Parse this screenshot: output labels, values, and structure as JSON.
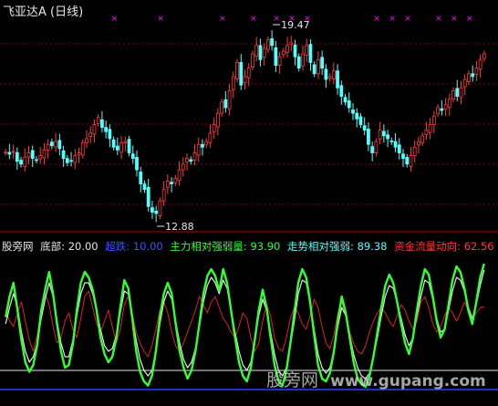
{
  "header": {
    "title": "飞亚达A (日线)"
  },
  "price": {
    "high_label": "19.47",
    "low_label": "12.88"
  },
  "legend": {
    "source": "股旁网",
    "bottom_label": "底部:",
    "bottom_value": "20.00",
    "super_label": "超跌:",
    "super_value": "10.00",
    "main_label": "主力相对强弱量:",
    "main_value": "93.90",
    "trend_label": "走势相对强弱:",
    "trend_value": "89.38",
    "flow_label": "资金流量动向:",
    "flow_value": "62.56"
  },
  "watermark": {
    "cn": "股旁网",
    "url": "www.gupang.com"
  },
  "colors": {
    "up": "#ff3b3b",
    "down": "#54ffff",
    "signal": "#ff00ff",
    "green": "#33ff33",
    "white": "#e6e6e6",
    "blue": "#2a40ff",
    "red": "#e02020",
    "grid": "#8a0000"
  },
  "chart_data": [
    {
      "type": "candlestick",
      "title": "飞亚达A (日线)",
      "annotations": [
        {
          "label": "19.47",
          "value": 19.47
        },
        {
          "label": "12.88",
          "value": 12.88
        }
      ],
      "close": [
        15.22,
        15.15,
        15.25,
        14.9,
        14.8,
        15.05,
        15.2,
        15.0,
        14.95,
        15.1,
        15.3,
        15.5,
        15.45,
        15.6,
        15.35,
        15.0,
        14.85,
        14.9,
        15.1,
        15.2,
        15.55,
        15.7,
        15.9,
        16.2,
        16.45,
        16.1,
        15.95,
        15.7,
        15.4,
        15.3,
        15.55,
        15.6,
        15.2,
        15.0,
        14.6,
        14.1,
        13.9,
        13.3,
        13.1,
        13.05,
        13.5,
        13.9,
        14.2,
        14.1,
        14.3,
        14.6,
        14.8,
        15.0,
        14.9,
        15.2,
        15.5,
        15.4,
        15.6,
        15.9,
        16.2,
        16.6,
        17.0,
        16.8,
        17.4,
        17.9,
        18.4,
        17.6,
        17.9,
        18.2,
        18.7,
        19.0,
        18.5,
        18.9,
        19.2,
        19.0,
        18.3,
        18.6,
        18.8,
        19.0,
        19.1,
        18.6,
        18.2,
        18.7,
        19.0,
        18.4,
        18.0,
        18.5,
        18.2,
        17.8,
        17.9,
        18.1,
        17.5,
        17.2,
        17.0,
        16.8,
        16.6,
        16.4,
        16.2,
        16.0,
        15.5,
        15.2,
        15.6,
        16.0,
        15.8,
        15.7,
        15.6,
        15.4,
        15.2,
        15.0,
        14.8,
        15.1,
        15.4,
        15.6,
        15.8,
        16.0,
        16.2,
        16.5,
        16.8,
        16.7,
        16.9,
        17.1,
        17.4,
        17.2,
        17.5,
        17.8,
        18.0,
        17.9,
        18.2,
        18.5,
        18.7
      ]
    },
    {
      "type": "line",
      "series": [
        {
          "name": "主力相对强弱量",
          "color": "#33ff33",
          "values": [
            55,
            70,
            80,
            60,
            38,
            22,
            15,
            20,
            35,
            60,
            75,
            88,
            72,
            50,
            30,
            18,
            20,
            35,
            60,
            80,
            88,
            84,
            75,
            60,
            40,
            28,
            22,
            26,
            40,
            62,
            82,
            76,
            55,
            30,
            15,
            8,
            5,
            12,
            30,
            55,
            72,
            80,
            72,
            50,
            30,
            18,
            10,
            16,
            30,
            50,
            72,
            85,
            90,
            85,
            74,
            90,
            80,
            60,
            40,
            22,
            12,
            8,
            18,
            38,
            60,
            75,
            62,
            40,
            20,
            8,
            5,
            16,
            36,
            58,
            80,
            90,
            84,
            66,
            42,
            20,
            10,
            8,
            14,
            30,
            52,
            70,
            58,
            40,
            22,
            10,
            6,
            4,
            12,
            26,
            44,
            62,
            78,
            86,
            80,
            66,
            50,
            36,
            28,
            40,
            60,
            78,
            90,
            86,
            70,
            52,
            40,
            46,
            64,
            82,
            92,
            88,
            76,
            60,
            50,
            66,
            84,
            93.9
          ]
        },
        {
          "name": "走势相对强弱",
          "color": "#e6e6e6",
          "values": [
            50,
            62,
            72,
            62,
            44,
            30,
            22,
            26,
            36,
            54,
            68,
            80,
            70,
            52,
            36,
            26,
            26,
            38,
            56,
            72,
            80,
            80,
            72,
            60,
            46,
            34,
            30,
            32,
            42,
            58,
            74,
            72,
            56,
            38,
            24,
            16,
            12,
            16,
            30,
            50,
            66,
            74,
            68,
            52,
            36,
            24,
            18,
            22,
            32,
            48,
            66,
            78,
            84,
            80,
            72,
            82,
            76,
            60,
            44,
            30,
            20,
            16,
            22,
            38,
            56,
            68,
            60,
            44,
            28,
            16,
            12,
            18,
            34,
            52,
            72,
            82,
            80,
            66,
            46,
            28,
            18,
            14,
            18,
            30,
            48,
            62,
            56,
            42,
            28,
            18,
            12,
            10,
            14,
            26,
            40,
            56,
            70,
            78,
            76,
            66,
            54,
            42,
            34,
            40,
            56,
            70,
            82,
            80,
            68,
            54,
            44,
            46,
            60,
            74,
            84,
            82,
            74,
            62,
            54,
            64,
            78,
            89.38
          ]
        },
        {
          "name": "资金流量动向",
          "color": "#e02020",
          "values": [
            60,
            52,
            48,
            58,
            66,
            52,
            38,
            30,
            42,
            60,
            72,
            64,
            48,
            36,
            40,
            52,
            58,
            46,
            40,
            54,
            70,
            74,
            62,
            50,
            44,
            52,
            60,
            48,
            36,
            46,
            64,
            70,
            58,
            44,
            36,
            30,
            26,
            34,
            46,
            60,
            66,
            58,
            44,
            34,
            30,
            36,
            44,
            52,
            60,
            70,
            64,
            58,
            66,
            70,
            62,
            54,
            50,
            44,
            40,
            48,
            58,
            54,
            40,
            30,
            36,
            52,
            64,
            56,
            40,
            32,
            30,
            40,
            54,
            62,
            58,
            50,
            46,
            56,
            68,
            62,
            48,
            36,
            32,
            42,
            58,
            66,
            56,
            44,
            36,
            30,
            28,
            34,
            44,
            52,
            58,
            62,
            58,
            52,
            48,
            56,
            64,
            60,
            52,
            46,
            52,
            66,
            70,
            62,
            50,
            44,
            48,
            56,
            62,
            58,
            52,
            58,
            66,
            60,
            54,
            58,
            62,
            62.56
          ]
        }
      ],
      "levels": [
        {
          "name": "底部",
          "value": 20
        },
        {
          "name": "超跌",
          "value": 10
        }
      ],
      "ylim": [
        0,
        100
      ]
    }
  ]
}
